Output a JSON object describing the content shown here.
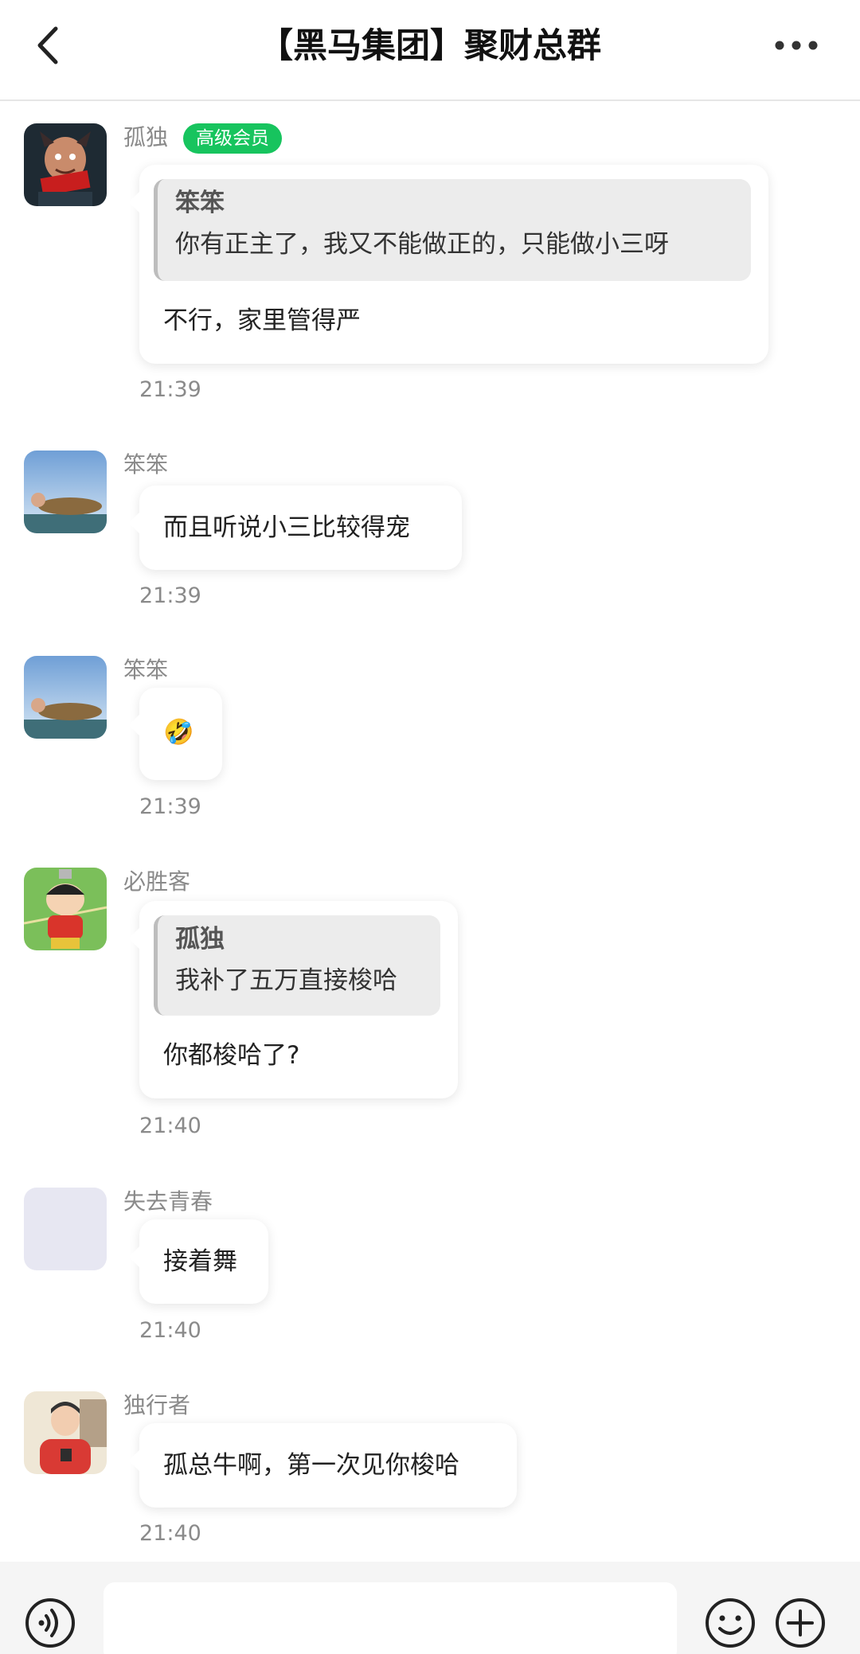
{
  "header": {
    "title": "【黑马集团】聚财总群",
    "back_icon": "chevron-left-icon",
    "more_icon": "more-horizontal-icon"
  },
  "messages": [
    {
      "sender": "孤独",
      "badge": "高级会员",
      "quote_name": "笨笨",
      "quote_text": "你有正主了，我又不能做正的，只能做小三呀",
      "text": "不行，家里管得严",
      "time": "21:39"
    },
    {
      "sender": "笨笨",
      "text": "而且听说小三比较得宠",
      "time": "21:39"
    },
    {
      "sender": "笨笨",
      "text": "🤣",
      "time": "21:39"
    },
    {
      "sender": "必胜客",
      "quote_name": "孤独",
      "quote_text": "我补了五万直接梭哈",
      "text": "你都梭哈了?",
      "time": "21:40"
    },
    {
      "sender": "失去青春",
      "text": "接着舞",
      "time": "21:40"
    },
    {
      "sender": "独行者",
      "text": "孤总牛啊，第一次见你梭哈",
      "time": "21:40"
    }
  ],
  "input_bar": {
    "placeholder": "",
    "voice_icon": "voice-icon",
    "emoji_icon": "emoji-icon",
    "plus_icon": "plus-circle-icon"
  },
  "colors": {
    "badge": "#17c45e",
    "bubble": "#ffffff",
    "quote_bg": "#ececec",
    "meta_text": "#8a8a8a"
  }
}
